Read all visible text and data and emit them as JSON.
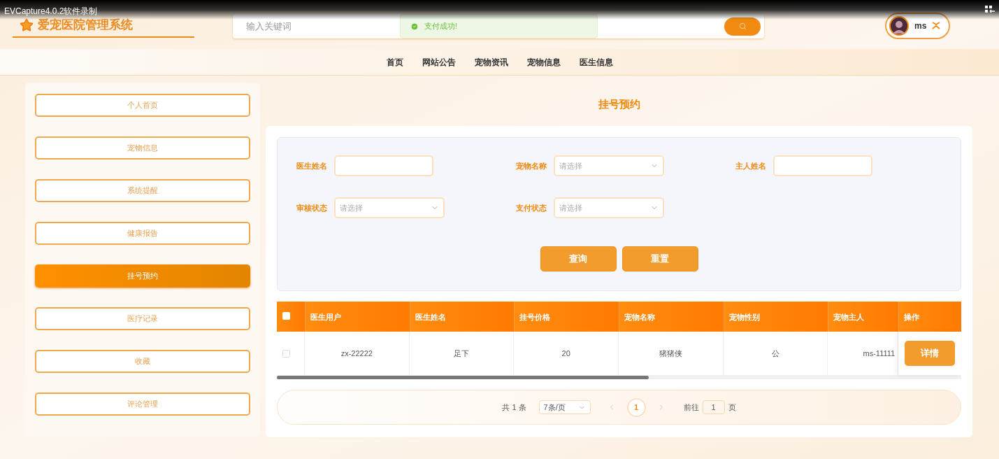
{
  "recorder": {
    "title": "EVCapture4.0.2软件录制"
  },
  "header": {
    "logo_text": "爱宠医院管理系统",
    "search": {
      "placeholder": "输入关键词"
    },
    "toast": {
      "text": "支付成功!"
    },
    "user": {
      "name": "ms"
    }
  },
  "nav": [
    {
      "label": "首页"
    },
    {
      "label": "网站公告"
    },
    {
      "label": "宠物资讯"
    },
    {
      "label": "宠物信息"
    },
    {
      "label": "医生信息"
    }
  ],
  "sidebar": [
    {
      "label": "个人首页",
      "selected": false
    },
    {
      "label": "宠物信息",
      "selected": false
    },
    {
      "label": "系统提醒",
      "selected": false
    },
    {
      "label": "健康报告",
      "selected": false
    },
    {
      "label": "挂号预约",
      "selected": true
    },
    {
      "label": "医疗记录",
      "selected": false
    },
    {
      "label": "收藏",
      "selected": false
    },
    {
      "label": "评论管理",
      "selected": false
    }
  ],
  "page_title": "挂号预约",
  "filters": [
    {
      "label": "医生姓名",
      "kind": "text"
    },
    {
      "label": "宠物名称",
      "kind": "select",
      "placeholder": "请选择"
    },
    {
      "label": "主人姓名",
      "kind": "text"
    },
    {
      "label": "审核状态",
      "kind": "select",
      "placeholder": "请选择"
    },
    {
      "label": "支付状态",
      "kind": "select",
      "placeholder": "请选择"
    }
  ],
  "buttons": [
    "查询",
    "重置"
  ],
  "table": {
    "select_all": {
      "checked": false
    },
    "columns": [
      "医生用户",
      "医生姓名",
      "挂号价格",
      "宠物名称",
      "宠物性别",
      "宠物主人",
      "操作"
    ],
    "rows": [
      {
        "checked": false,
        "cells": [
          "zx-22222",
          "足下",
          "20",
          "猪猪侠",
          "公",
          "ms-11111"
        ],
        "action": "详情"
      }
    ]
  },
  "pagination": {
    "total": "共 1 条",
    "page_size": "7条/页",
    "pages": [
      {
        "label": "1",
        "selected": true
      }
    ],
    "goto_label": "前往",
    "goto_value": "1",
    "page_suffix": "页"
  }
}
